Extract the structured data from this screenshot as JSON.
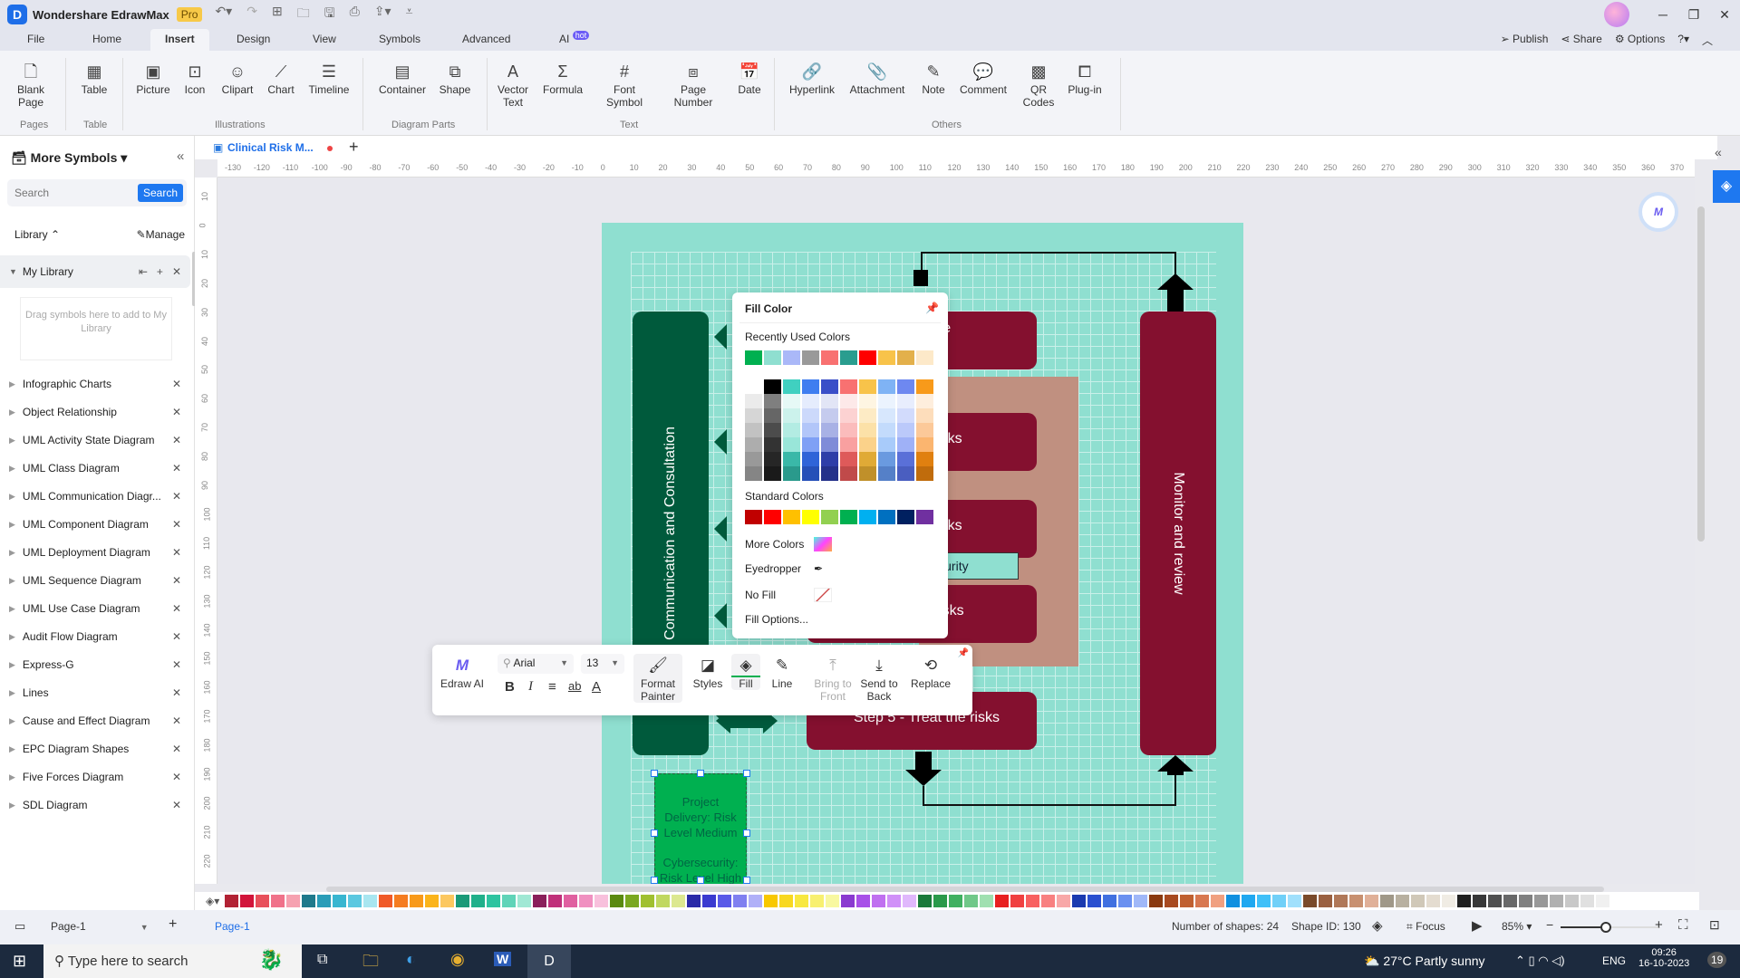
{
  "app": {
    "name": "Wondershare EdrawMax",
    "badge": "Pro"
  },
  "menu": {
    "tabs": [
      "File",
      "Home",
      "Insert",
      "Design",
      "View",
      "Symbols",
      "Advanced",
      "AI"
    ],
    "active_tab": "Insert",
    "ai_badge": "hot",
    "right": [
      "Publish",
      "Share",
      "Options"
    ]
  },
  "ribbon": {
    "buttons": [
      {
        "label": "Blank Page",
        "icon": "blank-page-icon"
      },
      {
        "label": "Table",
        "icon": "table-icon"
      },
      {
        "label": "Picture",
        "icon": "picture-icon"
      },
      {
        "label": "Icon",
        "icon": "icon-icon"
      },
      {
        "label": "Clipart",
        "icon": "clipart-icon"
      },
      {
        "label": "Chart",
        "icon": "chart-icon"
      },
      {
        "label": "Timeline",
        "icon": "timeline-icon"
      },
      {
        "label": "Container",
        "icon": "container-icon"
      },
      {
        "label": "Shape",
        "icon": "shape-icon"
      },
      {
        "label": "Vector Text",
        "icon": "vector-text-icon"
      },
      {
        "label": "Formula",
        "icon": "formula-icon"
      },
      {
        "label": "Font Symbol",
        "icon": "font-symbol-icon"
      },
      {
        "label": "Page Number",
        "icon": "page-number-icon"
      },
      {
        "label": "Date",
        "icon": "date-icon"
      },
      {
        "label": "Hyperlink",
        "icon": "hyperlink-icon"
      },
      {
        "label": "Attachment",
        "icon": "attachment-icon"
      },
      {
        "label": "Note",
        "icon": "note-icon"
      },
      {
        "label": "Comment",
        "icon": "comment-icon"
      },
      {
        "label": "QR Codes",
        "icon": "qr-code-icon"
      },
      {
        "label": "Plug-in",
        "icon": "plugin-icon"
      }
    ],
    "groups": [
      "Pages",
      "Table",
      "Illustrations",
      "Diagram Parts",
      "Text",
      "Others"
    ]
  },
  "left_panel": {
    "title": "More Symbols",
    "search_placeholder": "Search",
    "search_button": "Search",
    "library_label": "Library",
    "manage_label": "Manage",
    "my_library": "My Library",
    "drop_hint": "Drag symbols here to add to My Library",
    "libraries": [
      "Infographic Charts",
      "Object Relationship",
      "UML Activity State Diagram",
      "UML Class Diagram",
      "UML Communication Diagr...",
      "UML Component Diagram",
      "UML Deployment Diagram",
      "UML Sequence Diagram",
      "UML Use Case Diagram",
      "Audit Flow Diagram",
      "Express-G",
      "Lines",
      "Cause and Effect Diagram",
      "EPC Diagram Shapes",
      "Five Forces Diagram",
      "SDL Diagram"
    ]
  },
  "document": {
    "tab_title": "Clinical Risk M...",
    "unsaved": true
  },
  "rulers": {
    "horizontal": [
      "-130",
      "-120",
      "-110",
      "-100",
      "-90",
      "-80",
      "-70",
      "-60",
      "-50",
      "-40",
      "-30",
      "-20",
      "-10",
      "0",
      "10",
      "20",
      "30",
      "40",
      "50",
      "60",
      "70",
      "80",
      "90",
      "100",
      "110",
      "120",
      "130",
      "140",
      "150",
      "160",
      "170",
      "180",
      "190",
      "200",
      "210",
      "220",
      "230",
      "240",
      "250",
      "260",
      "270",
      "280",
      "290",
      "300",
      "310",
      "320",
      "330",
      "340",
      "350",
      "360",
      "370"
    ],
    "vertical": [
      "10",
      "0",
      "10",
      "20",
      "30",
      "40",
      "50",
      "60",
      "70",
      "80",
      "90",
      "100",
      "110",
      "120",
      "130",
      "140",
      "150",
      "160",
      "170",
      "180",
      "190",
      "200",
      "210",
      "220"
    ]
  },
  "diagram": {
    "communication": "Communication and Consultation",
    "monitor": "Monitor and review",
    "step1_partial": "ish the",
    "step3_partial": "the risks",
    "step4_partial": "the risks",
    "step4b_partial": "the risks",
    "step5": "Step 5 - Treat the risks",
    "cyber_label": "Cybersecurity",
    "selected_text_1": "Project Delivery: Risk Level Medium",
    "selected_text_2": "Cybersecurity: Risk Level High",
    "colors": {
      "page_bg": "#8fdfd0",
      "green_dark": "#005a3c",
      "maroon": "#84102f",
      "tan": "#c09080",
      "selected_fill": "#00b050"
    }
  },
  "fill_popup": {
    "title": "Fill Color",
    "recent_label": "Recently Used Colors",
    "recent_colors": [
      "#00b050",
      "#8fdfd0",
      "#aab8f8",
      "#999999",
      "#f87171",
      "#2a9d8f",
      "#ff0000",
      "#f8c34a",
      "#e3b04b",
      "#fde9c9"
    ],
    "theme_top": [
      "#ffffff",
      "#000000",
      "#40d0c0",
      "#3f7ef0",
      "#3a4fc8",
      "#f87171",
      "#f8c34a",
      "#7fb3f5",
      "#6e88f0",
      "#f89a1a"
    ],
    "theme_columns": [
      [
        "#ebebeb",
        "#d6d6d6",
        "#c2c2c2",
        "#adadad",
        "#999999",
        "#858585"
      ],
      [
        "#7f7f7f",
        "#666666",
        "#4c4c4c",
        "#333333",
        "#262626",
        "#1a1a1a"
      ],
      [
        "#e6f9f6",
        "#ccf2ec",
        "#b3ece3",
        "#99e6d9",
        "#3ab8a8",
        "#2a9a8c"
      ],
      [
        "#e5ecfd",
        "#ccd9fb",
        "#b2c6f9",
        "#7fa0f5",
        "#2f64d8",
        "#2550b8"
      ],
      [
        "#e2e5f6",
        "#c5cbee",
        "#a8b1e5",
        "#7f8cd8",
        "#2e3ea8",
        "#24318a"
      ],
      [
        "#fde9e9",
        "#fcd2d2",
        "#fbbcbc",
        "#f9a0a0",
        "#de5a5a",
        "#c04a4a"
      ],
      [
        "#fef5e2",
        "#fdebc5",
        "#fce1a8",
        "#fbd28a",
        "#e0aa36",
        "#c0902a"
      ],
      [
        "#ebf3fe",
        "#d7e7fd",
        "#c3dbfc",
        "#a8cbfa",
        "#6a9ae0",
        "#5580c8"
      ],
      [
        "#e8edfd",
        "#d2dbfc",
        "#bbc9fa",
        "#9fb1f7",
        "#5a70d8",
        "#4a5ec0"
      ],
      [
        "#feeedd",
        "#fdddbb",
        "#fcc999",
        "#fbb56f",
        "#e08010",
        "#c06c0c"
      ]
    ],
    "standard_label": "Standard Colors",
    "standard_colors": [
      "#c00000",
      "#ff0000",
      "#ffc000",
      "#ffff00",
      "#92d050",
      "#00b050",
      "#00b0f0",
      "#0070c0",
      "#002060",
      "#7030a0"
    ],
    "more_colors": "More Colors",
    "eyedropper": "Eyedropper",
    "no_fill": "No Fill",
    "fill_options": "Fill Options..."
  },
  "float_toolbar": {
    "edraw_ai": "Edraw AI",
    "font": "Arial",
    "size": "13",
    "format_painter": "Format Painter",
    "styles": "Styles",
    "fill": "Fill",
    "line": "Line",
    "bring_front": "Bring to Front",
    "send_back": "Send to Back",
    "replace": "Replace"
  },
  "color_strip": [
    "#b22234",
    "#d2143a",
    "#e8505b",
    "#f0728a",
    "#f6a1b0",
    "#1f7a8c",
    "#2a9db8",
    "#38b6d0",
    "#5bc8e0",
    "#a8e6f0",
    "#f05a28",
    "#f57c20",
    "#f89a1a",
    "#fbb41a",
    "#fcc860",
    "#1a9a78",
    "#20b08a",
    "#2ec4a0",
    "#60d4b8",
    "#a0e8d4",
    "#8a1f5a",
    "#c0307a",
    "#e060a0",
    "#f090c0",
    "#f8c0dc",
    "#5a8a10",
    "#7aa820",
    "#a0c030",
    "#c0d860",
    "#dce890",
    "#2a2aa8",
    "#3a3ad0",
    "#5a5ae8",
    "#8080f0",
    "#b0b0f8",
    "#f8c800",
    "#f8d820",
    "#f8e840",
    "#f8f070",
    "#f8f8a0",
    "#8a3ad0",
    "#a850e8",
    "#c070f0",
    "#d090f8",
    "#e0b8fc",
    "#1a7a3a",
    "#2a9a4a",
    "#40b060",
    "#70c888",
    "#a0e0b0",
    "#e82020",
    "#f04040",
    "#f86060",
    "#f88080",
    "#f8a8a8",
    "#1a3ab0",
    "#2a50d0",
    "#4070e0",
    "#6a90f0",
    "#a0b8f8",
    "#8a3a10",
    "#a84a20",
    "#c06030",
    "#d87850",
    "#f0a080",
    "#1090e0",
    "#20a8f0",
    "#40c0f8",
    "#70d0f8",
    "#a0e0fc",
    "#7a4a2a",
    "#9a6040",
    "#b07858",
    "#c89070",
    "#e0b098",
    "#a09888",
    "#b8b0a0",
    "#d0c8b8",
    "#e4dcd0",
    "#f0ece4",
    "#202020",
    "#383838",
    "#505050",
    "#686868",
    "#808080",
    "#989898",
    "#b0b0b0",
    "#c8c8c8",
    "#e0e0e0",
    "#f0f0f0"
  ],
  "status": {
    "page_selector": "Page-1",
    "page_tab": "Page-1",
    "shapes": "Number of shapes: 24",
    "shape_id": "Shape ID: 130",
    "focus": "Focus",
    "zoom": "85%",
    "zoom_fraction": 0.45
  },
  "taskbar": {
    "search_placeholder": "Type here to search",
    "weather": "27°C  Partly sunny",
    "lang": "ENG",
    "time": "09:26",
    "date": "16-10-2023",
    "notifications": "19"
  }
}
